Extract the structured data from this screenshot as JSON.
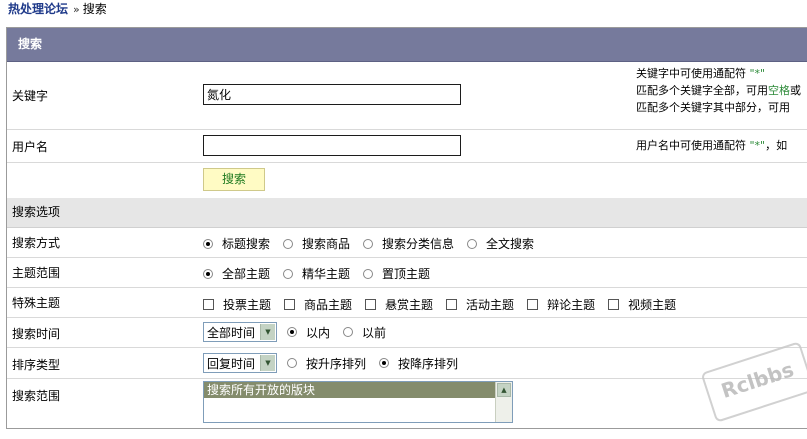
{
  "breadcrumb": {
    "site": "热处理论坛",
    "sep": "»",
    "current": "搜索"
  },
  "header": {
    "title": "搜索"
  },
  "keyword": {
    "label": "关键字",
    "value": "氮化",
    "tips": {
      "line1_prefix": "关键字中可使用通配符",
      "line1_wild": "\"*\"",
      "line2_prefix": "匹配多个关键字全部，可用",
      "line2_green": "空格",
      "line2_tail": "或",
      "line3": "匹配多个关键字其中部分，可用"
    }
  },
  "username": {
    "label": "用户名",
    "value": "",
    "tip_prefix": "用户名中可使用通配符",
    "tip_wild": "\"*\"",
    "tip_tail": "，如"
  },
  "search_button": "搜索",
  "options_title": "搜索选项",
  "search_mode": {
    "label": "搜索方式",
    "options": [
      "标题搜索",
      "搜索商品",
      "搜索分类信息",
      "全文搜索"
    ],
    "selected": 0
  },
  "thread_scope": {
    "label": "主题范围",
    "options": [
      "全部主题",
      "精华主题",
      "置顶主题"
    ],
    "selected": 0
  },
  "special_threads": {
    "label": "特殊主题",
    "options": [
      "投票主题",
      "商品主题",
      "悬赏主题",
      "活动主题",
      "辩论主题",
      "视频主题"
    ]
  },
  "search_time": {
    "label": "搜索时间",
    "select_value": "全部时间",
    "options": [
      "以内",
      "以前"
    ],
    "selected": 0
  },
  "sort": {
    "label": "排序类型",
    "select_value": "回复时间",
    "options": [
      "按升序排列",
      "按降序排列"
    ],
    "selected": 1
  },
  "search_range": {
    "label": "搜索范围",
    "first_item": "搜索所有开放的版块"
  },
  "watermark": "Rclbbs"
}
